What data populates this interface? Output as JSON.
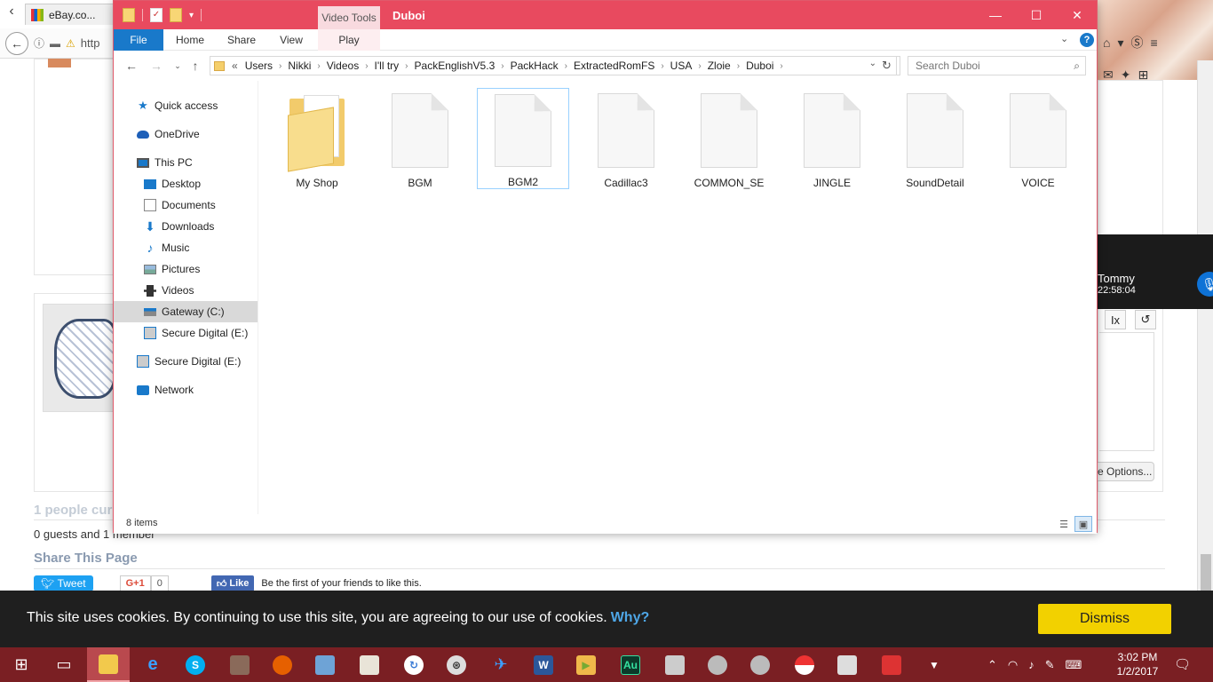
{
  "browser": {
    "tab_title": "eBay.co...",
    "url_partial": "http"
  },
  "background_page": {
    "people_text": "1 people cur",
    "guests_text": "0 guests and 1 member",
    "share_title": "Share This Page",
    "tweet_label": "Tweet",
    "gplus_label": "G+1",
    "gplus_count": "0",
    "fb_like_label": "Like",
    "fb_text": "Be the first of your friends to like this.",
    "more_options": "e Options..."
  },
  "cookie_bar": {
    "message": "This site uses cookies. By continuing to use this site, you are agreeing to our use of cookies.",
    "why_link": "Why?",
    "dismiss_label": "Dismiss"
  },
  "skype": {
    "brand": "skype",
    "caller_name": "Tommy",
    "call_time": "22:58:04"
  },
  "explorer": {
    "context_tab": "Video Tools",
    "window_title": "Duboi",
    "ribbon_tabs": [
      "File",
      "Home",
      "Share",
      "View",
      "Play"
    ],
    "help": "?",
    "breadcrumb": [
      "Users",
      "Nikki",
      "Videos",
      "I'll try",
      "PackEnglishV5.3",
      "PackHack",
      "ExtractedRomFS",
      "USA",
      "Zloie",
      "Duboi"
    ],
    "overflow": "«",
    "search_placeholder": "Search Duboi",
    "nav": {
      "quick_access": "Quick access",
      "onedrive": "OneDrive",
      "this_pc": "This PC",
      "desktop": "Desktop",
      "documents": "Documents",
      "downloads": "Downloads",
      "music": "Music",
      "pictures": "Pictures",
      "videos": "Videos",
      "gateway": "Gateway (C:)",
      "secure_digital_sub": "Secure Digital (E:)",
      "secure_digital": "Secure Digital (E:)",
      "network": "Network"
    },
    "files": [
      "My Shop",
      "BGM",
      "BGM2",
      "Cadillac3",
      "COMMON_SE",
      "JINGLE",
      "SoundDetail",
      "VOICE"
    ],
    "selected_file": "BGM2",
    "status_count": "8 items"
  },
  "taskbar": {
    "time": "3:02 PM",
    "date": "1/2/2017",
    "word_label": "W",
    "audition_label": "Au"
  },
  "colors": {
    "title_bar": "#e84a5f",
    "file_tab": "#1979ca",
    "taskbar": "#7a1f23",
    "dismiss": "#f2d100",
    "why_link": "#4ea6e6"
  }
}
